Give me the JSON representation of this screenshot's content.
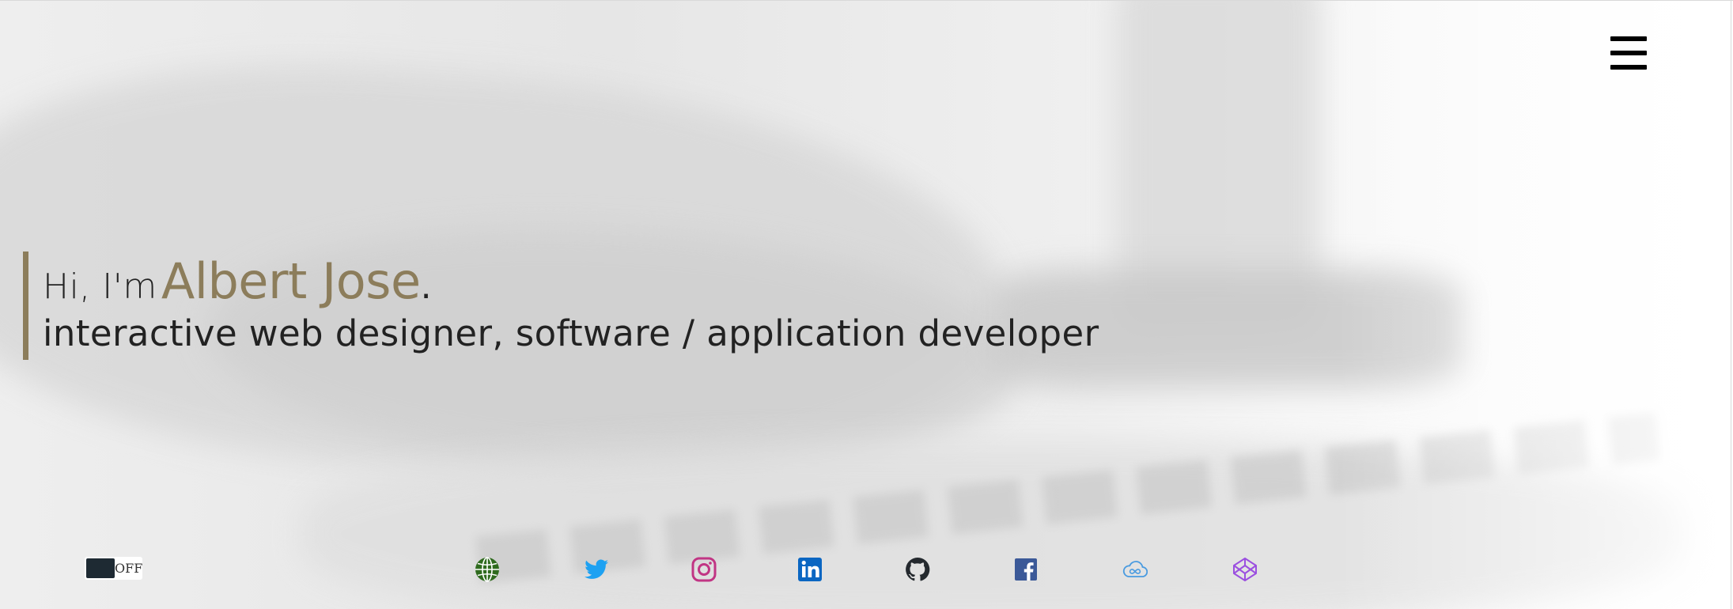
{
  "hero": {
    "greeting": "Hi, I'm",
    "name": "Albert Jose",
    "period": ".",
    "tagline": "interactive web designer, software / application developer"
  },
  "toggle": {
    "label": "OFF"
  },
  "social_icons": [
    "globe-icon",
    "twitter-icon",
    "instagram-icon",
    "linkedin-icon",
    "github-icon",
    "facebook-icon",
    "cloud-infinity-icon",
    "codepen-icon"
  ],
  "colors": {
    "accent": "#8c7d5b",
    "text": "#222222",
    "toggle_knob": "#1e2a33",
    "globe": "#2f6b1e",
    "twitter": "#1da1f2",
    "instagram": "#c13584",
    "linkedin": "#0a66c2",
    "github": "#24292e",
    "facebook": "#3b5998",
    "cloud": "#4a9be0",
    "codepen": "#9b4fe0"
  }
}
